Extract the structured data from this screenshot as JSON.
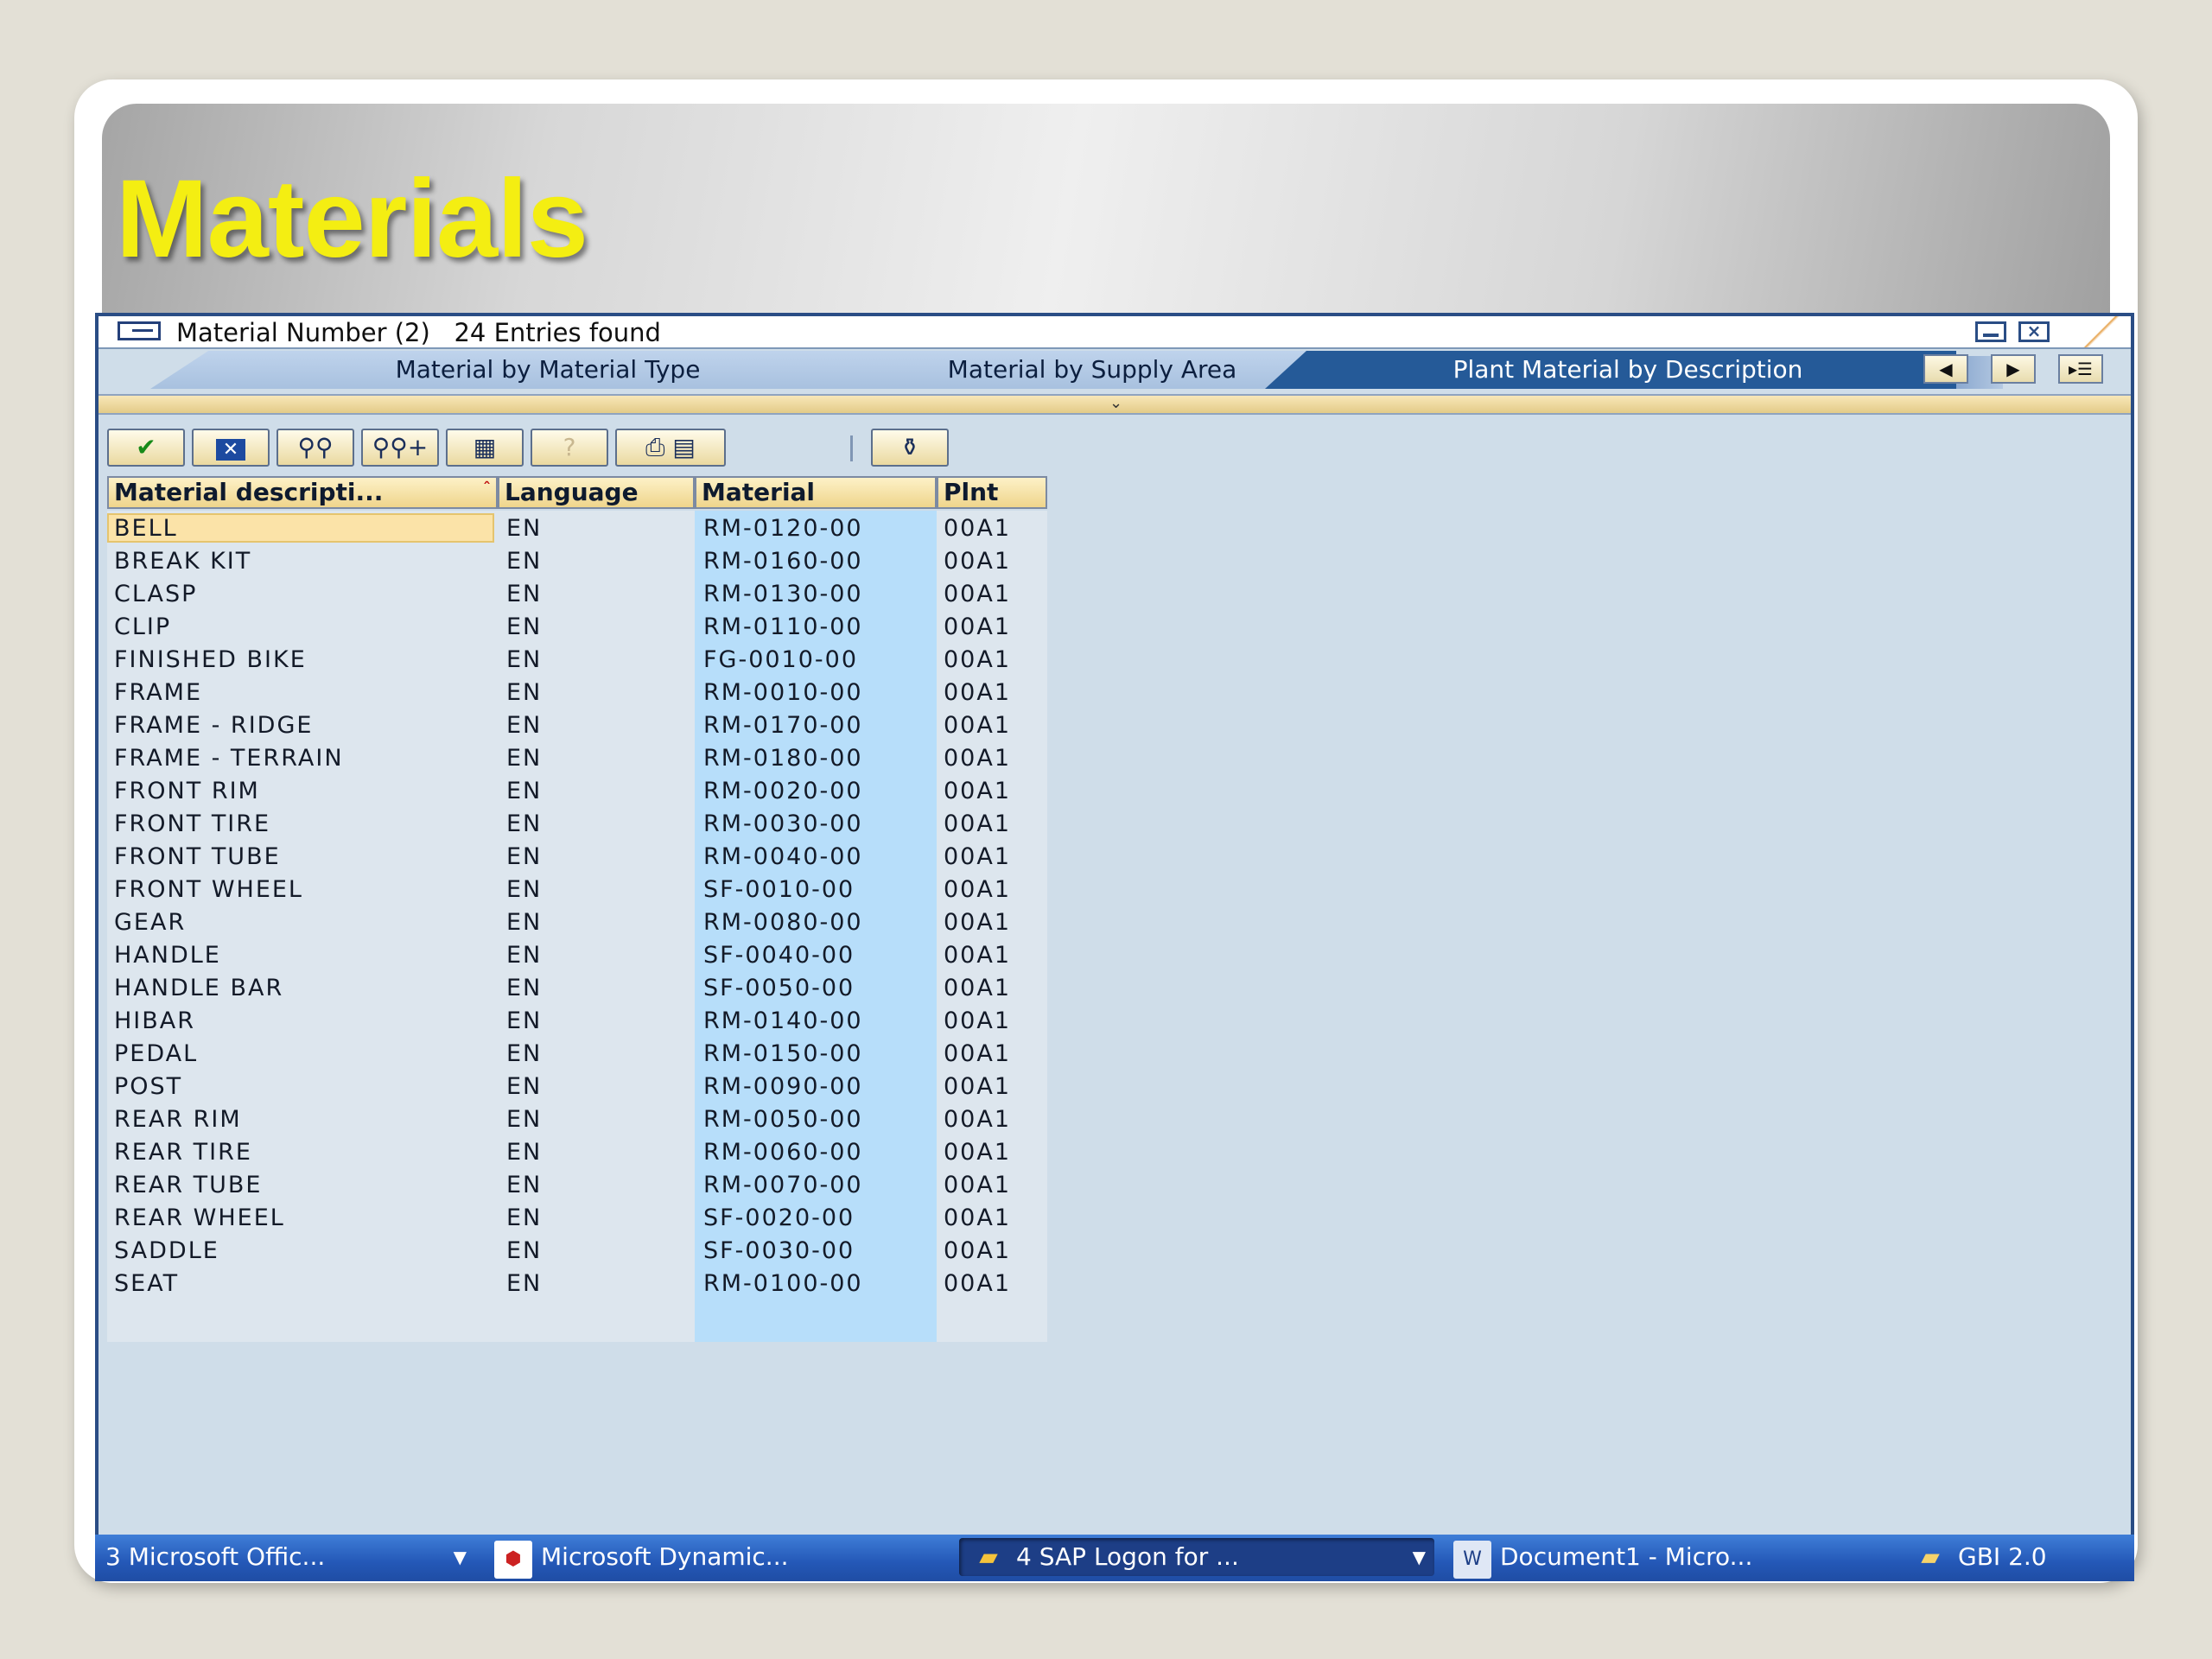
{
  "slide": {
    "title": "Materials"
  },
  "dialog": {
    "title": "Material Number (2)   24 Entries found",
    "tabs": [
      {
        "label": "Material by Material Type",
        "active": false
      },
      {
        "label": "Material by Supply Area",
        "active": false
      },
      {
        "label": "Plant Material by Description",
        "active": true
      }
    ],
    "toolbar_icons": [
      "checkmark-icon",
      "cancel-icon",
      "find-icon",
      "find-next-icon",
      "sort-icon",
      "help-icon",
      "print-icon",
      "copy-icon",
      "personal-list-icon"
    ],
    "columns": [
      "Material descripti...",
      "Language",
      "Material",
      "Plnt"
    ],
    "rows": [
      [
        "BELL",
        "EN",
        "RM-0120-00",
        "00A1"
      ],
      [
        "BREAK KIT",
        "EN",
        "RM-0160-00",
        "00A1"
      ],
      [
        "CLASP",
        "EN",
        "RM-0130-00",
        "00A1"
      ],
      [
        "CLIP",
        "EN",
        "RM-0110-00",
        "00A1"
      ],
      [
        "FINISHED BIKE",
        "EN",
        "FG-0010-00",
        "00A1"
      ],
      [
        "FRAME",
        "EN",
        "RM-0010-00",
        "00A1"
      ],
      [
        "FRAME - RIDGE",
        "EN",
        "RM-0170-00",
        "00A1"
      ],
      [
        "FRAME - TERRAIN",
        "EN",
        "RM-0180-00",
        "00A1"
      ],
      [
        "FRONT RIM",
        "EN",
        "RM-0020-00",
        "00A1"
      ],
      [
        "FRONT TIRE",
        "EN",
        "RM-0030-00",
        "00A1"
      ],
      [
        "FRONT TUBE",
        "EN",
        "RM-0040-00",
        "00A1"
      ],
      [
        "FRONT WHEEL",
        "EN",
        "SF-0010-00",
        "00A1"
      ],
      [
        "GEAR",
        "EN",
        "RM-0080-00",
        "00A1"
      ],
      [
        "HANDLE",
        "EN",
        "SF-0040-00",
        "00A1"
      ],
      [
        "HANDLE BAR",
        "EN",
        "SF-0050-00",
        "00A1"
      ],
      [
        "HIBAR",
        "EN",
        "RM-0140-00",
        "00A1"
      ],
      [
        "PEDAL",
        "EN",
        "RM-0150-00",
        "00A1"
      ],
      [
        "POST",
        "EN",
        "RM-0090-00",
        "00A1"
      ],
      [
        "REAR RIM",
        "EN",
        "RM-0050-00",
        "00A1"
      ],
      [
        "REAR TIRE",
        "EN",
        "RM-0060-00",
        "00A1"
      ],
      [
        "REAR TUBE",
        "EN",
        "RM-0070-00",
        "00A1"
      ],
      [
        "REAR WHEEL",
        "EN",
        "SF-0020-00",
        "00A1"
      ],
      [
        "SADDLE",
        "EN",
        "SF-0030-00",
        "00A1"
      ],
      [
        "SEAT",
        "EN",
        "RM-0100-00",
        "00A1"
      ]
    ],
    "selected_row": 0
  },
  "taskbar": {
    "items": [
      {
        "label": "3 Microsoft Offic...",
        "icon": "",
        "active": false,
        "has_arrow": true
      },
      {
        "label": "Microsoft Dynamic...",
        "icon": "pdf-icon",
        "active": false,
        "has_arrow": false
      },
      {
        "label": "4 SAP Logon for ...",
        "icon": "folder-icon",
        "active": true,
        "has_arrow": true
      },
      {
        "label": "Document1 - Micro...",
        "icon": "word-icon",
        "active": false,
        "has_arrow": false
      },
      {
        "label": "GBI 2.0",
        "icon": "folder-icon",
        "active": false,
        "has_arrow": false
      }
    ]
  },
  "colors": {
    "title_yellow": "#f4ee12",
    "active_tab": "#255a98",
    "material_column": "#b7defa",
    "taskbar": "#2458b7"
  }
}
